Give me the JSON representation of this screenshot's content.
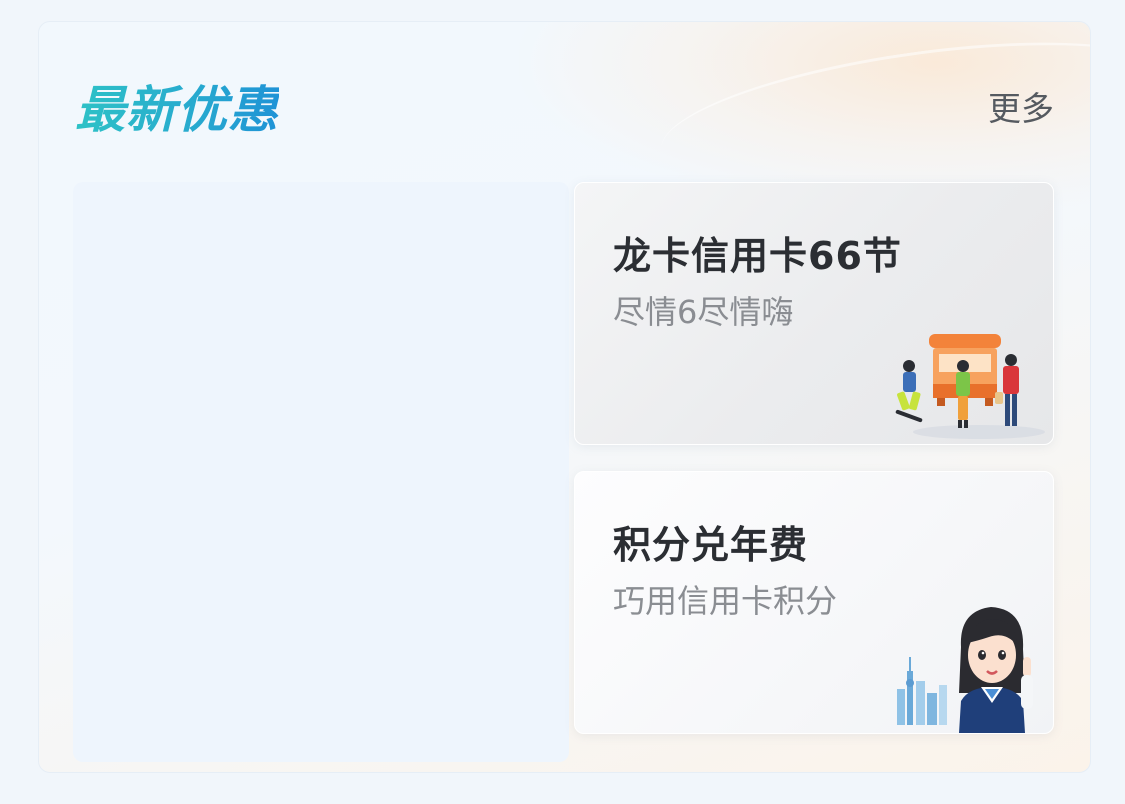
{
  "header": {
    "title": "最新优惠",
    "more_label": "更多"
  },
  "cards": [
    {
      "title": "龙卡信用卡66节",
      "subtitle": "尽情6尽情嗨",
      "illustration": "shopping-street-illustration"
    },
    {
      "title": "积分兑年费",
      "subtitle": "巧用信用卡积分",
      "illustration": "bank-staff-avatar-illustration"
    }
  ],
  "colors": {
    "title_gradient_start": "#2ec2c6",
    "title_gradient_end": "#1f93d6",
    "more_text": "#555a60",
    "card_title": "#2b2e33",
    "card_subtitle": "#8a8d92",
    "kiosk_orange": "#f3833a"
  }
}
